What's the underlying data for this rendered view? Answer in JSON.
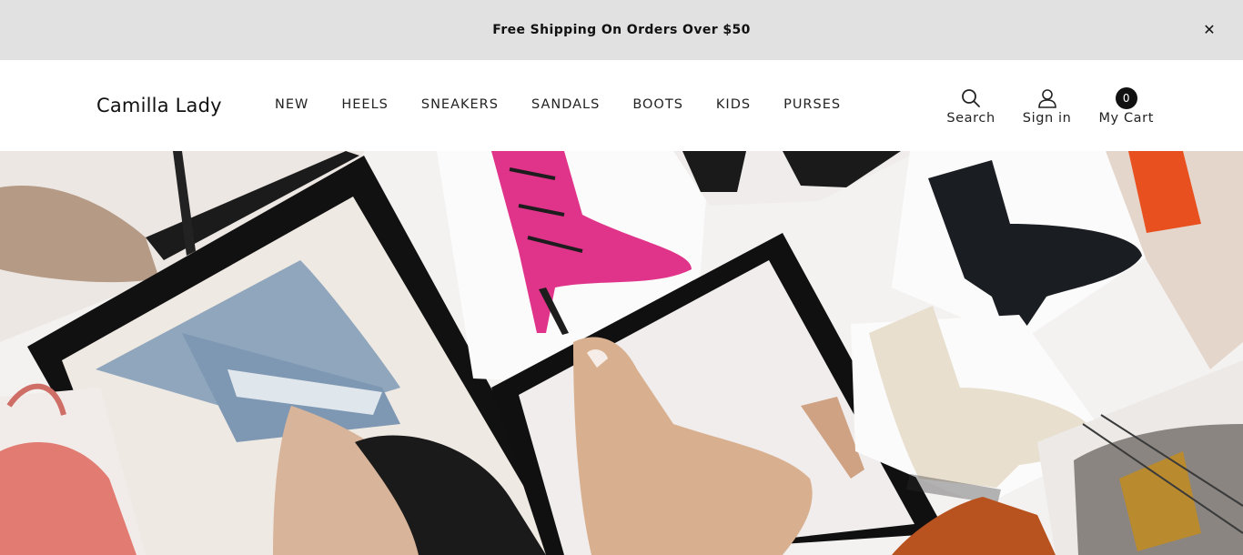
{
  "announcement": {
    "text": "Free Shipping On Orders Over $50",
    "close_icon": "close-icon"
  },
  "header": {
    "logo": "Camilla Lady",
    "nav": [
      {
        "label": "NEW"
      },
      {
        "label": "HEELS"
      },
      {
        "label": "SNEAKERS"
      },
      {
        "label": "SANDALS"
      },
      {
        "label": "BOOTS"
      },
      {
        "label": "KIDS"
      },
      {
        "label": "PURSES"
      }
    ],
    "tools": {
      "search_label": "Search",
      "search_icon": "search-icon",
      "signin_label": "Sign in",
      "signin_icon": "user-icon",
      "cart_label": "My Cart",
      "cart_count": "0"
    }
  },
  "hero": {
    "image": "collage of women's boots, heels and purses"
  },
  "colors": {
    "announce_bg": "#e1e1e1",
    "text": "#111111",
    "badge_bg": "#111111"
  }
}
